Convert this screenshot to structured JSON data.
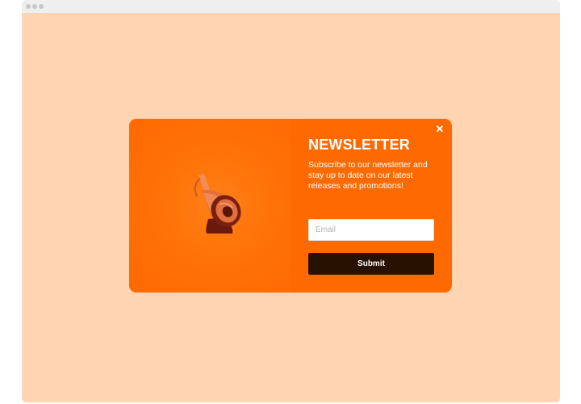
{
  "window": {
    "titlebar_dots": [
      "window-dot",
      "window-dot",
      "window-dot"
    ]
  },
  "popup": {
    "title": "NEWSLETTER",
    "description": "Subscribe to our newsletter and stay up to date on our latest releases and promotions!",
    "email": {
      "value": "",
      "placeholder": "Email"
    },
    "submit_label": "Submit",
    "close_label": "✕",
    "image_icon": "megaphone-icon"
  },
  "colors": {
    "page_background": "#ffd4b3",
    "popup_background": "#ff6a00",
    "submit_background": "#281100",
    "text": "#ffffff"
  }
}
